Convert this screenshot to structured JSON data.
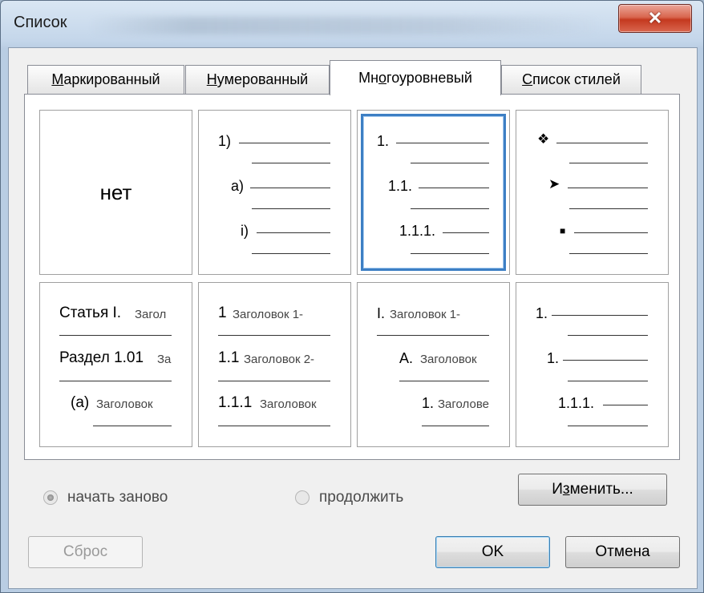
{
  "window": {
    "title": "Список"
  },
  "tabs": [
    {
      "label_pre": "",
      "label_u": "М",
      "label_post": "аркированный",
      "active": false
    },
    {
      "label_pre": "",
      "label_u": "Н",
      "label_post": "умерованный",
      "active": false
    },
    {
      "label_pre": "Мн",
      "label_u": "о",
      "label_post": "гоуровневый",
      "active": true
    },
    {
      "label_pre": "",
      "label_u": "С",
      "label_post": "писок стилей",
      "active": false
    }
  ],
  "tiles": {
    "none": {
      "label": "нет"
    },
    "t2": {
      "l1": "1)",
      "l2": "a)",
      "l3": "i)"
    },
    "t3": {
      "l1": "1.",
      "l2": "1.1.",
      "l3": "1.1.1."
    },
    "t4": {
      "icon1": "four-diamond-bullet-icon",
      "icon2": "arrow-bullet-icon",
      "icon3": "square-bullet-icon"
    },
    "t5": {
      "l1a": "Статья I.",
      "l1b": "Загол",
      "l2a": "Раздел 1.01",
      "l2b": "За",
      "l3a": "(a)",
      "l3b": "Заголовок"
    },
    "t6": {
      "l1a": "1",
      "l1b": "Заголовок 1-",
      "l2a": "1.1",
      "l2b": "Заголовок 2-",
      "l3a": "1.1.1",
      "l3b": "Заголовок"
    },
    "t7": {
      "l1a": "I.",
      "l1b": "Заголовок 1-",
      "l2a": "A.",
      "l2b": "Заголовок",
      "l3a": "1.",
      "l3b": "Заголове"
    },
    "t8": {
      "l1": "1.",
      "l2": "1.",
      "l3": "1.1.1."
    }
  },
  "options": {
    "restart": "начать заново",
    "continue": "продолжить"
  },
  "buttons": {
    "modify_pre": "И",
    "modify_u": "з",
    "modify_post": "менить...",
    "reset": "Сброс",
    "ok": "OK",
    "cancel": "Отмена"
  },
  "colors": {
    "selection": "#3d7fc4",
    "close": "#c4391f"
  }
}
